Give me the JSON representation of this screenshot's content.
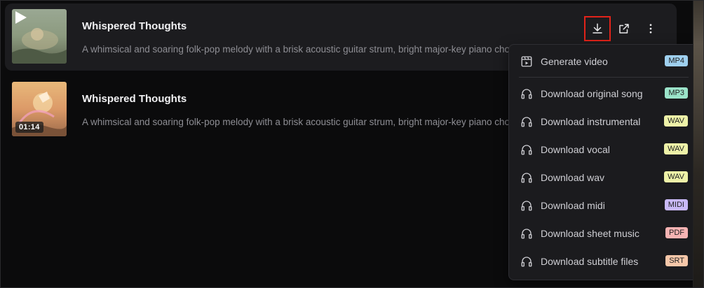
{
  "tracks": [
    {
      "title": "Whispered Thoughts",
      "description": "A whimsical and soaring folk-pop melody with a brisk acoustic guitar strum, bright major-key piano chords",
      "duration": ""
    },
    {
      "title": "Whispered Thoughts",
      "description": "A whimsical and soaring folk-pop melody with a brisk acoustic guitar strum, bright major-key piano chords",
      "duration": "01:14"
    }
  ],
  "actions": {
    "download": "download-icon",
    "share": "external-link-icon",
    "more": "more-vertical-icon"
  },
  "menu": {
    "items": [
      {
        "label": "Generate video",
        "badge": "MP4",
        "badge_color": "#9fd0ef",
        "icon": "video-icon"
      },
      {
        "label": "Download original song",
        "badge": "MP3",
        "badge_color": "#9be3c9",
        "icon": "headphones-icon"
      },
      {
        "label": "Download instrumental",
        "badge": "WAV",
        "badge_color": "#eef2a8",
        "icon": "headphones-icon"
      },
      {
        "label": "Download vocal",
        "badge": "WAV",
        "badge_color": "#eef2a8",
        "icon": "headphones-icon"
      },
      {
        "label": "Download wav",
        "badge": "WAV",
        "badge_color": "#eef2a8",
        "icon": "headphones-icon"
      },
      {
        "label": "Download midi",
        "badge": "MIDI",
        "badge_color": "#c9b9f7",
        "icon": "headphones-icon"
      },
      {
        "label": "Download sheet music",
        "badge": "PDF",
        "badge_color": "#f6b3b3",
        "icon": "headphones-icon"
      },
      {
        "label": "Download subtitle files",
        "badge": "SRT",
        "badge_color": "#f6c7a9",
        "icon": "headphones-icon"
      }
    ]
  }
}
